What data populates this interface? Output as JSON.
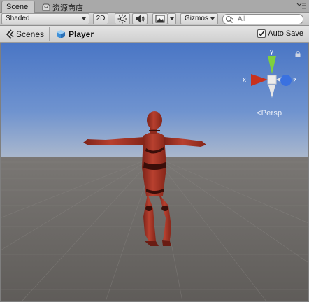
{
  "tabs": [
    {
      "label": "Scene"
    },
    {
      "label": "资源商店"
    }
  ],
  "toolbar": {
    "shading_mode": "Shaded",
    "mode_2d": "2D",
    "gizmos_label": "Gizmos",
    "search_placeholder": "All"
  },
  "breadcrumb": {
    "root": "Scenes",
    "current": "Player",
    "autosave_label": "Auto Save",
    "autosave_checked": true
  },
  "scene": {
    "projection_label": "Persp",
    "gizmo_axes": {
      "x": "x",
      "y": "y",
      "z": "z"
    }
  },
  "colors": {
    "sky_top": "#4d79c6",
    "sky_horizon": "#aab8cf",
    "ground": "#6b6865",
    "character": "#a83225",
    "axis_x": "#c8321e",
    "axis_y": "#7fd03e",
    "axis_z": "#3a71e0"
  }
}
